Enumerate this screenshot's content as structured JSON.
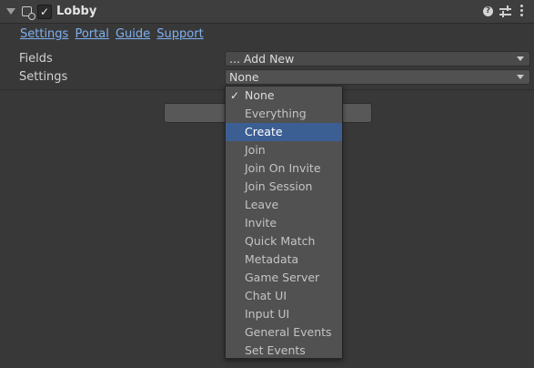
{
  "component": {
    "title": "Lobby",
    "enabled_check": "✓",
    "help_glyph": "?"
  },
  "links": [
    "Settings",
    "Portal",
    "Guide",
    "Support"
  ],
  "fields": {
    "label": "Fields",
    "value": "... Add New"
  },
  "settings": {
    "label": "Settings",
    "value": "None"
  },
  "menu": {
    "check_glyph": "✓",
    "checked_index": 0,
    "highlight_index": 2,
    "items": [
      "None",
      "Everything",
      "Create",
      "Join",
      "Join On Invite",
      "Join Session",
      "Leave",
      "Invite",
      "Quick Match",
      "Metadata",
      "Game Server",
      "Chat UI",
      "Input UI",
      "General Events",
      "Set Events"
    ]
  },
  "colors": {
    "link": "#7fb0f0",
    "highlight": "#3c5f93",
    "panel": "#383838"
  }
}
